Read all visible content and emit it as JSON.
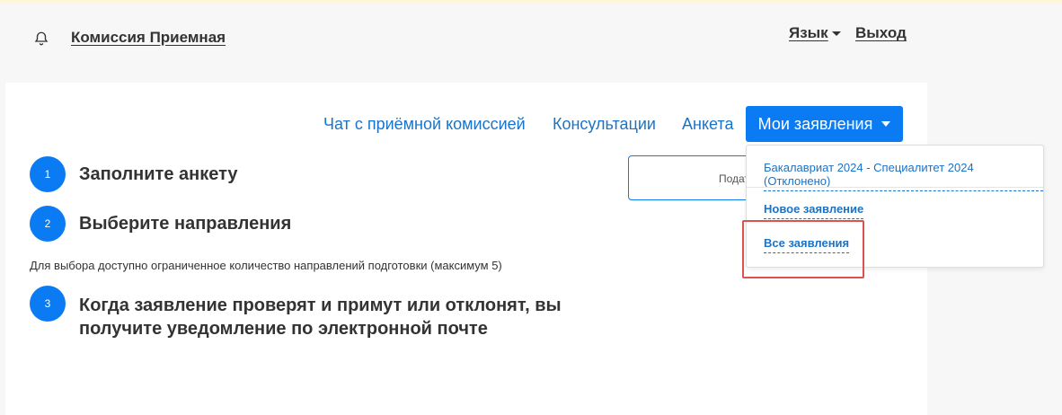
{
  "header": {
    "brand": "Комиссия Приемная",
    "language_label": "Язык",
    "logout_label": "Выход"
  },
  "nav": {
    "chat": "Чат с приёмной комиссией",
    "consultations": "Консультации",
    "form": "Анкета",
    "my_applications": "Мои заявления"
  },
  "dropdown": {
    "application": "Бакалавриат 2024 - Специалитет 2024 (Отклонено)",
    "new_application": "Новое заявление",
    "all_applications": "Все заявления"
  },
  "steps": [
    {
      "number": "1",
      "title": "Заполните анкету"
    },
    {
      "number": "2",
      "title": "Выберите направления"
    },
    {
      "number": "3",
      "title": "Когда заявление проверят и примут или отклонят, вы получите уведомление по электронной почте"
    }
  ],
  "note": "Для выбора доступно ограниченное количество направлений подготовки (максимум 5)",
  "submit_partial": "Подат",
  "colors": {
    "primary": "#0b7bf3",
    "link": "#1a73c8",
    "highlight": "#d9534f",
    "background": "#f7f7f8"
  },
  "icons": {
    "bell": "bell-icon",
    "caret": "caret-down-icon"
  }
}
